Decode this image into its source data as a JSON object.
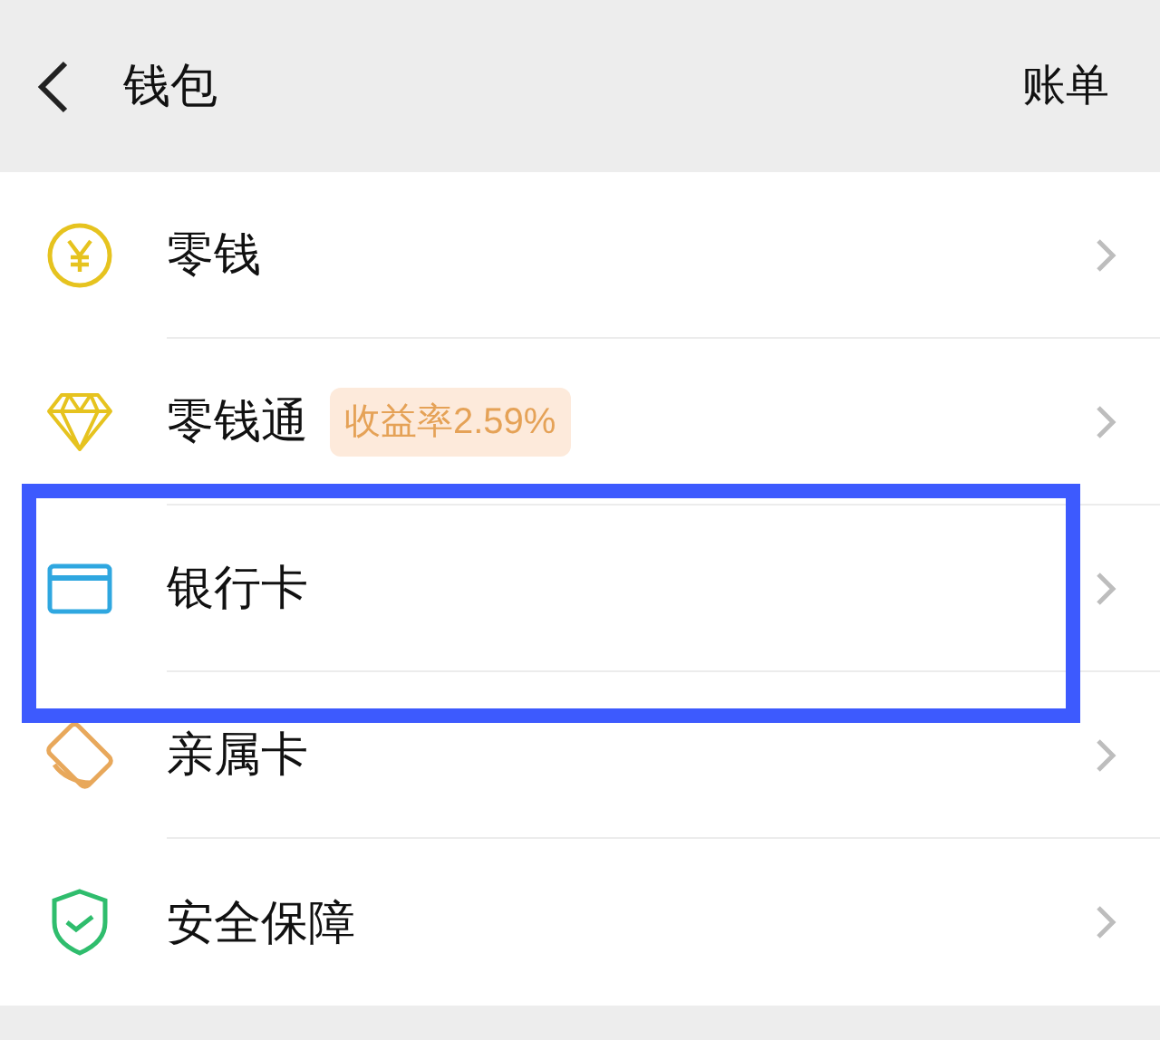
{
  "header": {
    "title": "钱包",
    "action": "账单"
  },
  "items": [
    {
      "kind": "coin",
      "label": "零钱",
      "highlighted": false
    },
    {
      "kind": "diamond",
      "label": "零钱通",
      "badge": "收益率2.59%",
      "highlighted": false
    },
    {
      "kind": "card",
      "label": "银行卡",
      "highlighted": true
    },
    {
      "kind": "family",
      "label": "亲属卡",
      "highlighted": false
    },
    {
      "kind": "shield",
      "label": "安全保障",
      "highlighted": false
    }
  ]
}
